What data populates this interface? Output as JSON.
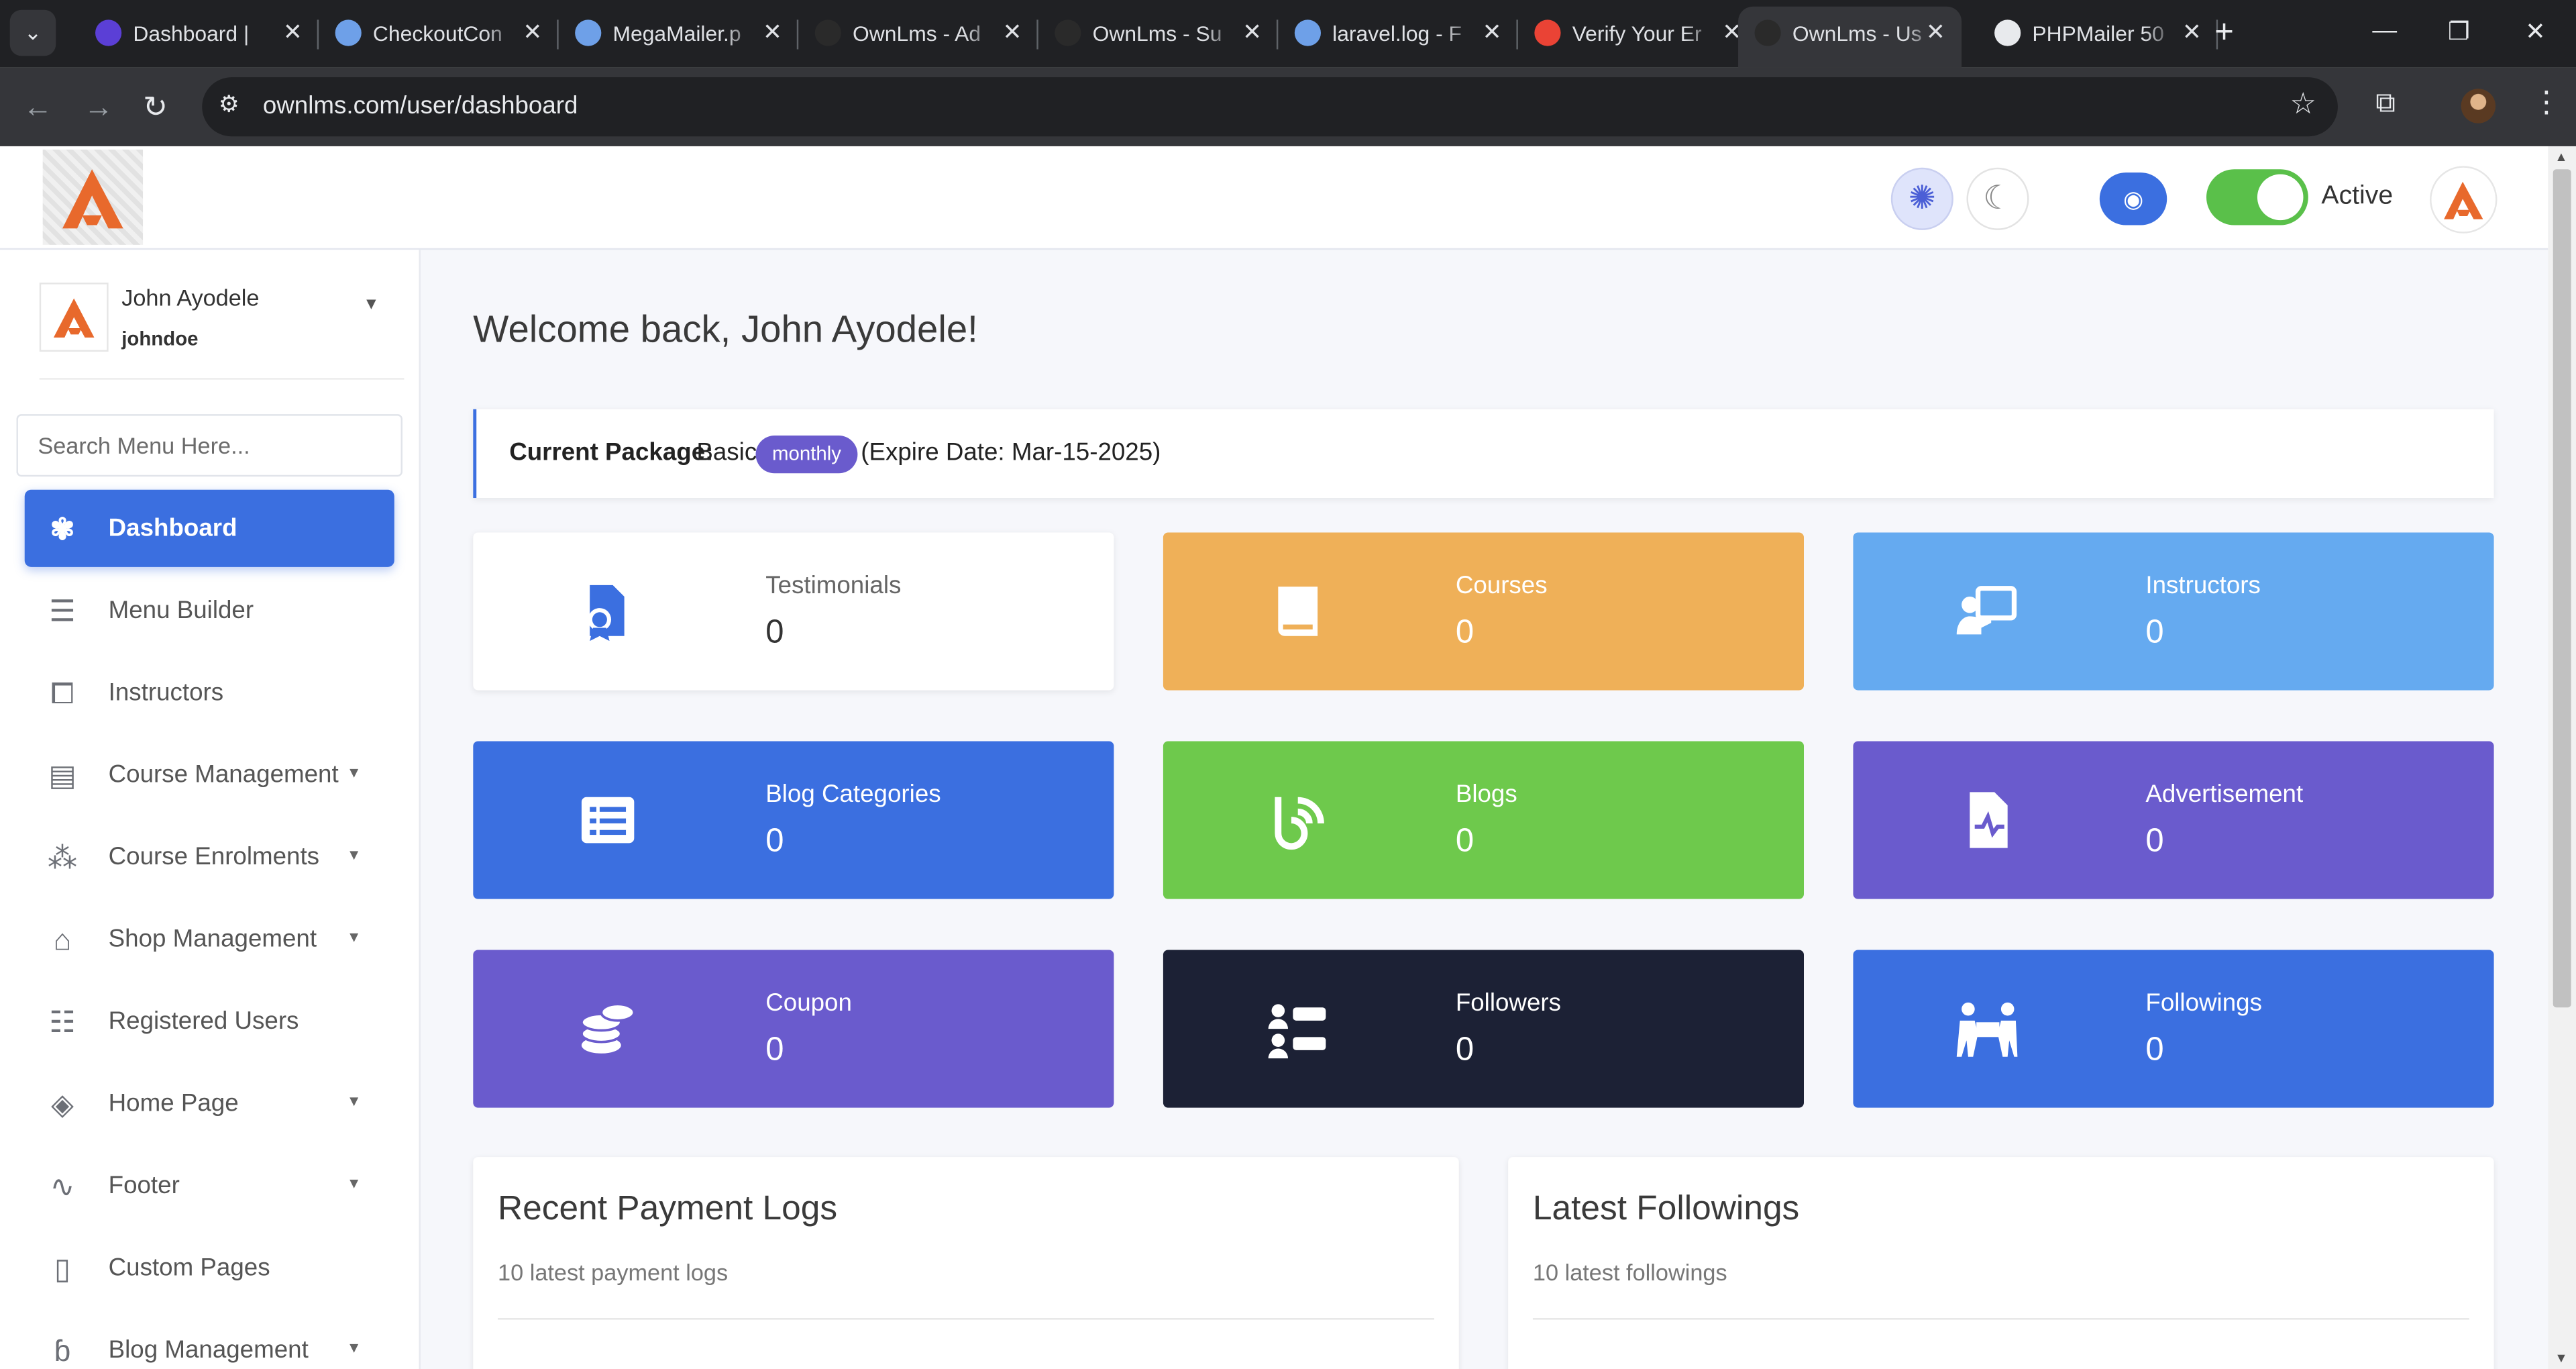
{
  "browser": {
    "tabs": [
      {
        "title": "Dashboard | ",
        "favicon_color": "#5b3fd6"
      },
      {
        "title": "CheckoutCon",
        "favicon_color": "#6ea0e8"
      },
      {
        "title": "MegaMailer.p",
        "favicon_color": "#6ea0e8"
      },
      {
        "title": "OwnLms - Ad",
        "favicon_color": "#2a2a2a"
      },
      {
        "title": "OwnLms - Su",
        "favicon_color": "#2a2a2a"
      },
      {
        "title": "laravel.log - F",
        "favicon_color": "#6ea0e8"
      },
      {
        "title": "Verify Your Er",
        "favicon_color": "#ea4335"
      },
      {
        "title": "OwnLms - Us",
        "favicon_color": "#2a2a2a",
        "active": true
      },
      {
        "title": "PHPMailer 50",
        "favicon_color": "#e8eaed"
      }
    ],
    "url": "ownlms.com/user/dashboard"
  },
  "topbar": {
    "status_label": "Active",
    "status_on": true
  },
  "sidebar": {
    "user_name": "John Ayodele",
    "user_handle": "johndoe",
    "search_placeholder": "Search Menu Here...",
    "items": [
      {
        "label": "Dashboard",
        "icon": "palette-icon",
        "selected": true,
        "caret": false
      },
      {
        "label": "Menu Builder",
        "icon": "bars-icon",
        "caret": false
      },
      {
        "label": "Instructors",
        "icon": "chalkboard-teacher-icon",
        "caret": false
      },
      {
        "label": "Course Management",
        "icon": "book-icon",
        "caret": true
      },
      {
        "label": "Course Enrolments",
        "icon": "users-grid-icon",
        "caret": true
      },
      {
        "label": "Shop Management",
        "icon": "store-icon",
        "caret": true
      },
      {
        "label": "Registered Users",
        "icon": "user-list-icon",
        "caret": false
      },
      {
        "label": "Home Page",
        "icon": "layers-icon",
        "caret": true
      },
      {
        "label": "Footer",
        "icon": "route-icon",
        "caret": true
      },
      {
        "label": "Custom Pages",
        "icon": "file-icon",
        "caret": false
      },
      {
        "label": "Blog Management",
        "icon": "blog-icon",
        "caret": true
      }
    ]
  },
  "main": {
    "welcome": "Welcome back, John Ayodele!",
    "package": {
      "label": "Current Package:",
      "name": "Basic",
      "badge": "monthly",
      "expire": "(Expire Date: Mar-15-2025)"
    },
    "cards": [
      {
        "title": "Testimonials",
        "value": "0",
        "icon": "certificate-icon",
        "color": "#ffffff"
      },
      {
        "title": "Courses",
        "value": "0",
        "icon": "book-icon",
        "color": "#efb058"
      },
      {
        "title": "Instructors",
        "value": "0",
        "icon": "chalkboard-teacher-icon",
        "color": "#65aaf0"
      },
      {
        "title": "Blog Categories",
        "value": "0",
        "icon": "list-icon",
        "color": "#3b6fe0"
      },
      {
        "title": "Blogs",
        "value": "0",
        "icon": "blog-icon",
        "color": "#6ec94c"
      },
      {
        "title": "Advertisement",
        "value": "0",
        "icon": "file-waveform-icon",
        "color": "#6a5bcd"
      },
      {
        "title": "Coupon",
        "value": "0",
        "icon": "coins-icon",
        "color": "#6a5bcd"
      },
      {
        "title": "Followers",
        "value": "0",
        "icon": "user-list-icon",
        "color": "#1c2135"
      },
      {
        "title": "Followings",
        "value": "0",
        "icon": "people-table-icon",
        "color": "#3b6fe0"
      }
    ],
    "panels": [
      {
        "title": "Recent Payment Logs",
        "subtitle": "10 latest payment logs"
      },
      {
        "title": "Latest Followings",
        "subtitle": "10 latest followings"
      }
    ]
  }
}
